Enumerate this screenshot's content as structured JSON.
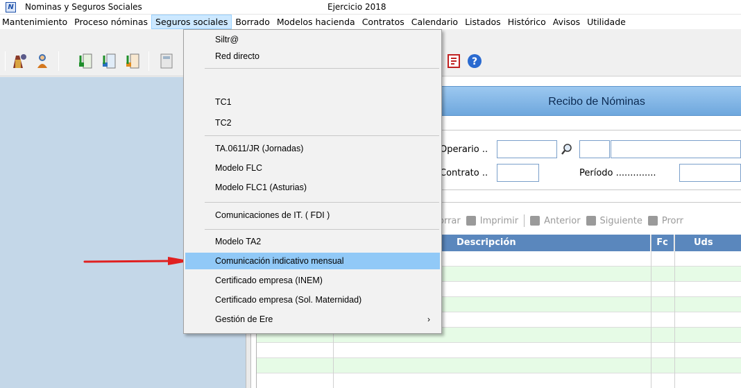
{
  "window": {
    "title": "Nominas y Seguros Sociales",
    "year": "Ejercicio 2018",
    "logo_letter": "N"
  },
  "menubar": {
    "items": [
      "Mantenimiento",
      "Proceso nóminas",
      "Seguros sociales",
      "Borrado",
      "Modelos hacienda",
      "Contratos",
      "Calendario",
      "Listados",
      "Histórico",
      "Avisos",
      "Utilidade"
    ]
  },
  "form": {
    "title": "Recibo de Nóminas",
    "operario_label": "Operario ..",
    "contrato_label": "Contrato ..",
    "periodo_label": "Período ..............",
    "actions": {
      "borrar": "orrar",
      "imprimir": "Imprimir",
      "anterior": "Anterior",
      "siguiente": "Siguiente",
      "prorr": "Prorr"
    },
    "grid_headers": {
      "descripcion": "Descripción",
      "fc": "Fc",
      "uds": "Uds"
    }
  },
  "dropdown": {
    "items": [
      "Siltr@",
      "Red directo",
      "TC1",
      "TC2",
      "TA.0611/JR (Jornadas)",
      "Modelo FLC",
      "Modelo FLC1 (Asturias)",
      "Comunicaciones de IT. ( FDI )",
      "Modelo TA2",
      "Comunicación indicativo mensual",
      "Certificado empresa (INEM)",
      "Certificado empresa (Sol. Maternidad)",
      "Gestión de Ere"
    ],
    "submenu_arrow": "›",
    "highlighted_index": 9
  },
  "colors": {
    "header_blue": "#6ea7dd",
    "grid_head": "#5a87bd",
    "row_alt": "#e6fbe6",
    "highlight": "#91c9f7",
    "arrow_red": "#e02020"
  }
}
